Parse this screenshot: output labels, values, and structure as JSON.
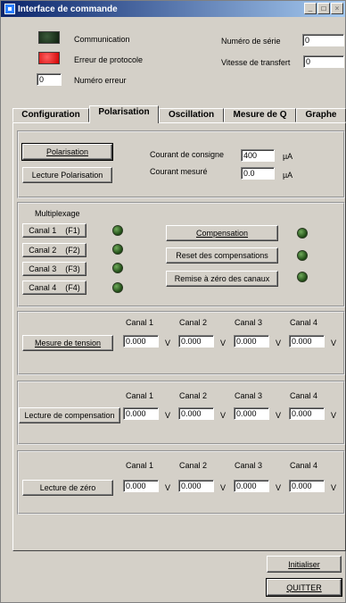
{
  "window": {
    "title": "Interface de commande",
    "min": "_",
    "max": "□",
    "close": "×"
  },
  "status": {
    "communication": "Communication",
    "erreur_protocole": "Erreur de protocole",
    "numero_erreur_label": "Numéro erreur",
    "numero_erreur_value": "0",
    "numero_serie_label": "Numéro de série",
    "numero_serie_value": "0",
    "vitesse_label": "Vitesse de transfert",
    "vitesse_value": "0"
  },
  "tabs": [
    "Configuration",
    "Polarisation",
    "Oscillation",
    "Mesure de Q",
    "Graphe"
  ],
  "polarisation": {
    "btn_polarisation": "Polarisation",
    "btn_lecture": "Lecture Polarisation",
    "consigne_label": "Courant de consigne",
    "consigne_value": "400",
    "consigne_unit": "µA",
    "mesure_label": "Courant mesuré",
    "mesure_value": "0.0",
    "mesure_unit": "µA"
  },
  "multiplexage": {
    "title": "Multiplexage",
    "canaux": [
      "Canal 1    (F1)",
      "Canal 2    (F2)",
      "Canal 3    (F3)",
      "Canal 4    (F4)"
    ],
    "btn_compensation": "Compensation",
    "btn_reset": "Reset des compensations",
    "btn_remise": "Remise à zéro des canaux"
  },
  "canal_headers": [
    "Canal 1",
    "Canal 2",
    "Canal 3",
    "Canal 4"
  ],
  "unit_v": "V",
  "tension": {
    "button": "Mesure de tension",
    "values": [
      "0.000",
      "0.000",
      "0.000",
      "0.000"
    ]
  },
  "compensation": {
    "button": "Lecture de compensation",
    "values": [
      "0.000",
      "0.000",
      "0.000",
      "0.000"
    ]
  },
  "zero": {
    "button": "Lecture de zéro",
    "values": [
      "0.000",
      "0.000",
      "0.000",
      "0.000"
    ]
  },
  "footer": {
    "initialiser": "Initialiser",
    "quitter": "QUITTER"
  }
}
